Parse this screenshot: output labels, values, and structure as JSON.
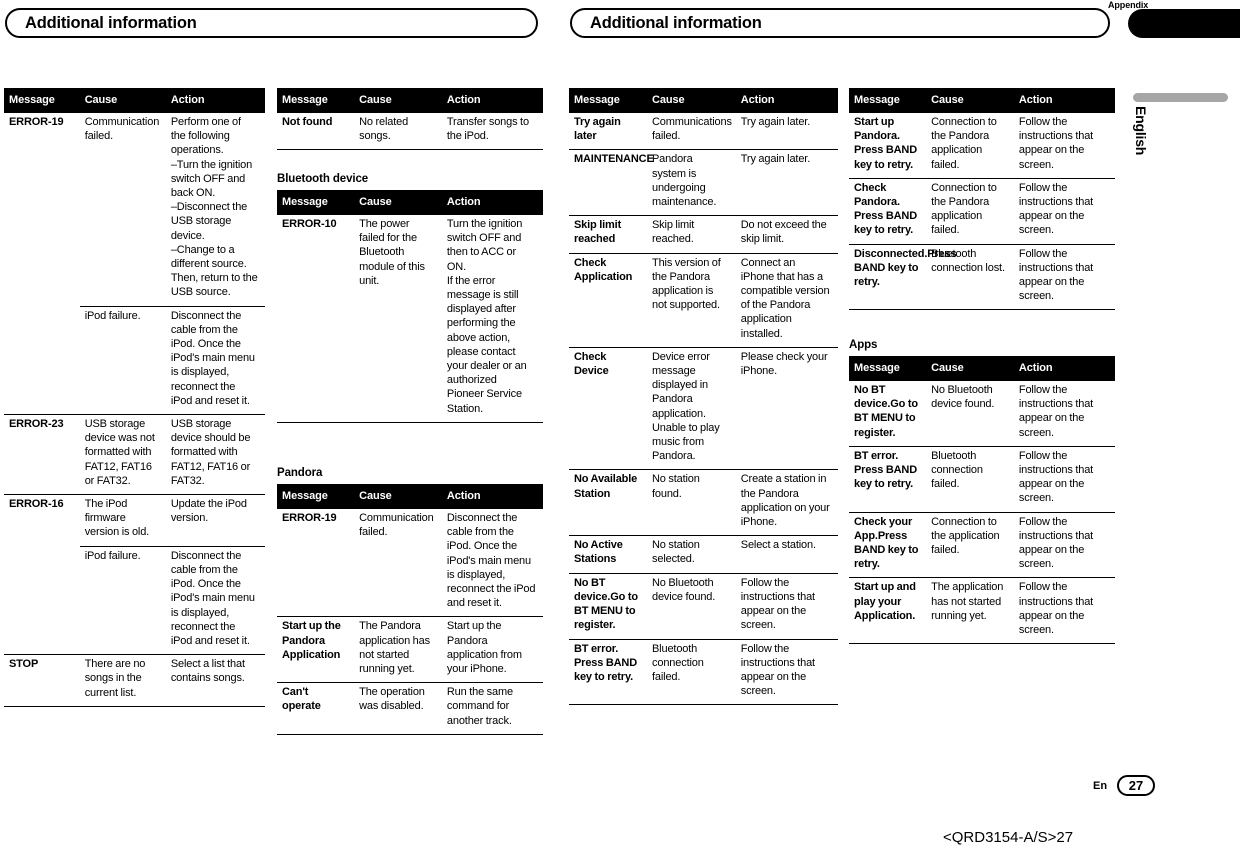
{
  "header": {
    "left_title": "Additional information",
    "right_title": "Additional information",
    "appendix_tab": "Appendix",
    "language_tab": "English"
  },
  "footer": {
    "lang_code": "En",
    "page_number": "27",
    "document_code": "<QRD3154-A/S>27"
  },
  "columns": {
    "headers": [
      "Message",
      "Cause",
      "Action"
    ]
  },
  "tables": [
    {
      "id": "table-ipod-usb",
      "section_title": "",
      "rows": [
        {
          "group": true,
          "message": "ERROR-19",
          "cause": "Communication failed.",
          "action": "Perform one of the following operations.\n–Turn the ignition switch OFF and back ON.\n–Disconnect the USB storage device.\n–Change to a different source. Then, return to the USB source."
        },
        {
          "group": false,
          "message": "",
          "cause": "iPod failure.",
          "action": "Disconnect the cable from the iPod. Once the iPod's main menu is displayed, reconnect the iPod and reset it."
        },
        {
          "group": true,
          "message": "ERROR-23",
          "cause": "USB storage device was not formatted with FAT12, FAT16 or FAT32.",
          "action": "USB storage device should be formatted with FAT12, FAT16 or FAT32."
        },
        {
          "group": true,
          "message": "ERROR-16",
          "cause": "The iPod firmware version is old.",
          "action": "Update the iPod version."
        },
        {
          "group": false,
          "message": "",
          "cause": "iPod failure.",
          "action": "Disconnect the cable from the iPod. Once the iPod's main menu is displayed, reconnect the iPod and reset it."
        },
        {
          "group": true,
          "last": true,
          "message": "STOP",
          "cause": "There are no songs in the current list.",
          "action": "Select a list that contains songs."
        }
      ]
    },
    {
      "id": "table-notfound",
      "section_title": "",
      "rows": [
        {
          "group": true,
          "last": true,
          "message": "Not found",
          "cause": "No related songs.",
          "action": "Transfer songs to the iPod."
        }
      ]
    },
    {
      "id": "table-bluetooth-device",
      "section_title": "Bluetooth device",
      "rows": [
        {
          "group": true,
          "last": true,
          "message": "ERROR-10",
          "cause": "The power failed for the Bluetooth module of this unit.",
          "action": "Turn the ignition switch OFF and then to ACC or ON.\nIf the error message is still displayed after performing the above action, please contact your dealer or an authorized Pioneer Service Station."
        }
      ]
    },
    {
      "id": "table-pandora-1",
      "section_title": "Pandora",
      "rows": [
        {
          "group": true,
          "message": "ERROR-19",
          "cause": "Communication failed.",
          "action": "Disconnect the cable from the iPod. Once the iPod's main menu is displayed, reconnect the iPod and reset it."
        },
        {
          "group": true,
          "message": "Start up the Pandora Application",
          "cause": "The Pandora application has not started running yet.",
          "action": "Start up the Pandora application from your iPhone."
        },
        {
          "group": true,
          "last": true,
          "message": "Can't operate",
          "cause": "The operation was disabled.",
          "action": "Run the same command for another track."
        }
      ]
    },
    {
      "id": "table-pandora-2",
      "section_title": "",
      "rows": [
        {
          "group": true,
          "message": "Try again later",
          "cause": "Communications failed.",
          "action": "Try again later."
        },
        {
          "group": true,
          "message": "MAINTENANCE",
          "cause": "Pandora system is undergoing maintenance.",
          "action": "Try again later."
        },
        {
          "group": true,
          "message": "Skip limit reached",
          "cause": "Skip limit reached.",
          "action": "Do not exceed the skip limit."
        },
        {
          "group": true,
          "message": "Check Application",
          "cause": "This version of the Pandora application is not supported.",
          "action": "Connect an iPhone that has a compatible version of the Pandora application installed."
        },
        {
          "group": true,
          "message": "Check Device",
          "cause": "Device error message displayed in Pandora application.\nUnable to play music from Pandora.",
          "action": "Please check your iPhone."
        },
        {
          "group": true,
          "message": "No Available Station",
          "cause": "No station found.",
          "action": "Create a station in the Pandora application on your iPhone."
        },
        {
          "group": true,
          "message": "No Active Stations",
          "cause": "No station selected.",
          "action": "Select a station."
        },
        {
          "group": true,
          "message": "No BT device.Go to BT MENU to register.",
          "cause": "No Bluetooth device found.",
          "action": "Follow the instructions that appear on the screen."
        },
        {
          "group": true,
          "last": true,
          "message": "BT error. Press BAND key to retry.",
          "cause": "Bluetooth connection failed.",
          "action": "Follow the instructions that appear on the screen."
        }
      ]
    },
    {
      "id": "table-pandora-3",
      "section_title": "",
      "rows": [
        {
          "group": true,
          "message": "Start up Pandora. Press BAND key to retry.",
          "cause": "Connection to the Pandora application failed.",
          "action": "Follow the instructions that appear on the screen."
        },
        {
          "group": true,
          "message": "Check Pandora. Press BAND key to retry.",
          "cause": "Connection to the Pandora application failed.",
          "action": "Follow the instructions that appear on the screen."
        },
        {
          "group": true,
          "last": true,
          "message": "Disconnected.Press BAND key to retry.",
          "cause": "Bluetooth connection lost.",
          "action": "Follow the instructions that appear on the screen."
        }
      ]
    },
    {
      "id": "table-apps",
      "section_title": "Apps",
      "rows": [
        {
          "group": true,
          "message": "No BT device.Go to BT MENU to register.",
          "cause": "No Bluetooth device found.",
          "action": "Follow the instructions that appear on the screen."
        },
        {
          "group": true,
          "message": "BT error. Press BAND key to retry.",
          "cause": "Bluetooth connection failed.",
          "action": "Follow the instructions that appear on the screen."
        },
        {
          "group": true,
          "message": "Check your App.Press BAND key to retry.",
          "cause": "Connection to the application failed.",
          "action": "Follow the instructions that appear on the screen."
        },
        {
          "group": true,
          "last": true,
          "message": "Start up and play your Application.",
          "cause": "The application has not started running yet.",
          "action": "Follow the instructions that appear on the screen."
        }
      ]
    }
  ]
}
